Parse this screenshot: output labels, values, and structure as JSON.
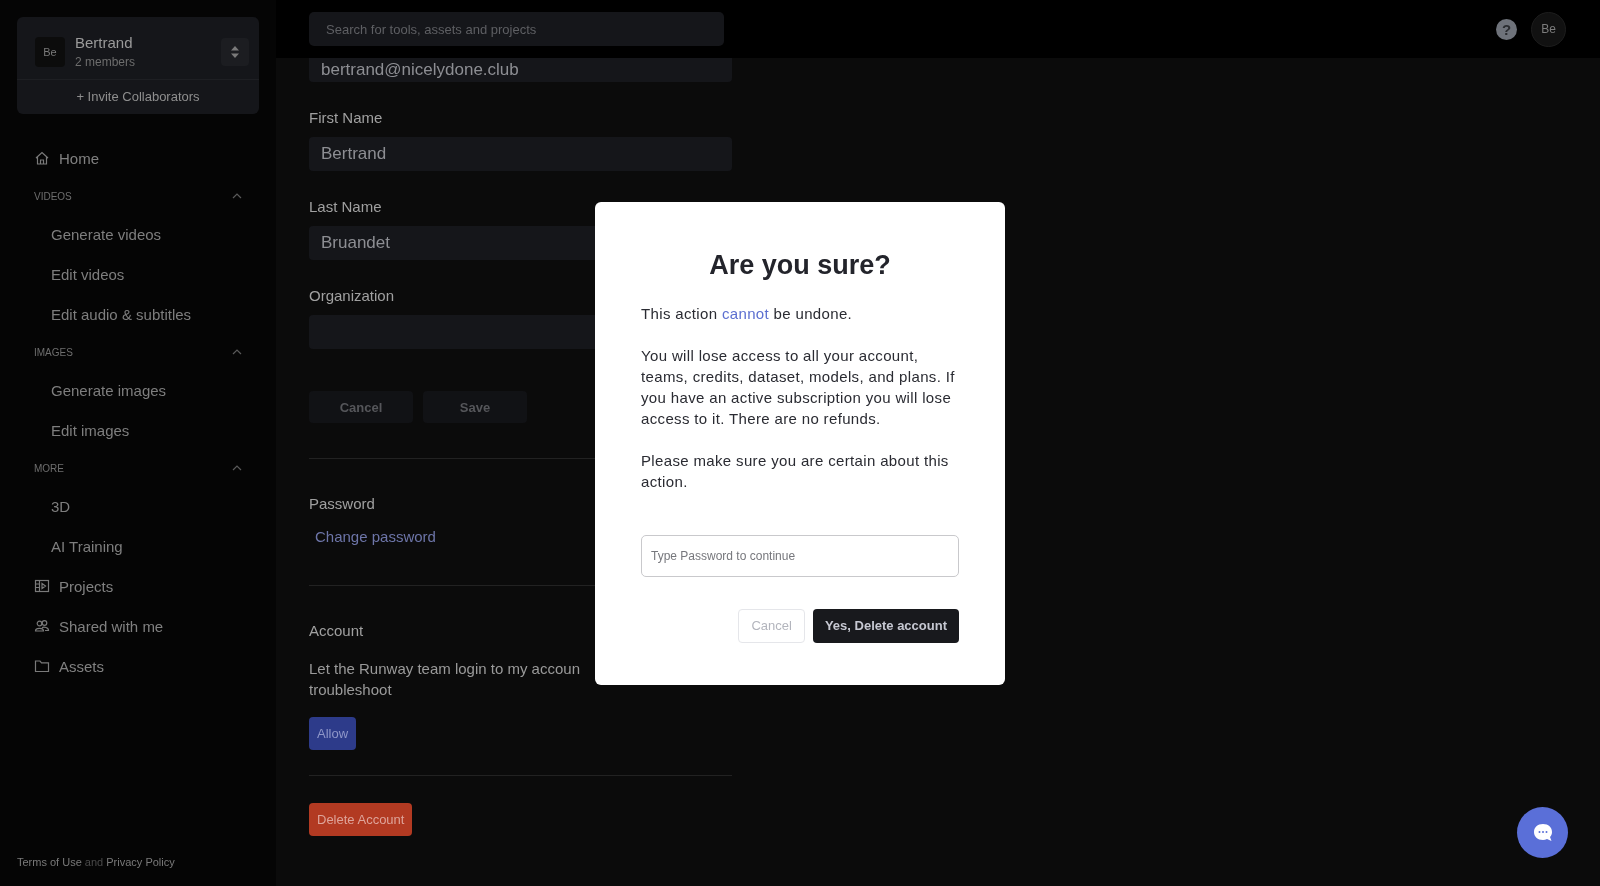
{
  "workspace": {
    "avatar": "Be",
    "name": "Bertrand",
    "members": "2 members",
    "invite": "+ Invite Collaborators"
  },
  "sidebar": {
    "items": [
      {
        "kind": "link",
        "label": "Home"
      },
      {
        "kind": "section",
        "label": "VIDEOS",
        "expanded": true,
        "children": [
          {
            "label": "Generate videos"
          },
          {
            "label": "Edit videos"
          },
          {
            "label": "Edit audio & subtitles"
          }
        ]
      },
      {
        "kind": "section",
        "label": "IMAGES",
        "expanded": true,
        "children": [
          {
            "label": "Generate images"
          },
          {
            "label": "Edit images"
          }
        ]
      },
      {
        "kind": "section",
        "label": "MORE",
        "expanded": true,
        "children": [
          {
            "label": "3D"
          },
          {
            "label": "AI Training"
          }
        ]
      },
      {
        "kind": "link",
        "label": "Projects"
      },
      {
        "kind": "link",
        "label": "Shared with me"
      },
      {
        "kind": "link",
        "label": "Assets"
      }
    ],
    "footer": {
      "terms": "Terms of Use",
      "and": "and",
      "privacy": "Privacy Policy"
    }
  },
  "header": {
    "search": {
      "placeholder": "Search for tools, assets and projects"
    },
    "help": "?",
    "avatar": "Be"
  },
  "profile": {
    "email": "bertrand@nicelydone.club",
    "fields": [
      {
        "label": "First Name",
        "value": "Bertrand"
      },
      {
        "label": "Last Name",
        "value": "Bruandet"
      },
      {
        "label": "Organization"
      }
    ],
    "buttons": [
      {
        "label": "Cancel",
        "disabled": true
      },
      {
        "label": "Save",
        "disabled": true
      }
    ],
    "password": {
      "label": "Password",
      "link": "Change password"
    },
    "account": {
      "label": "Account",
      "text_lines": [
        "Let the Runway team login to my accoun",
        "troubleshoot"
      ],
      "allow": "Allow"
    },
    "delete": "Delete Account"
  },
  "modal": {
    "title": "Are you sure?",
    "intro": {
      "before": "This action ",
      "emphasis": "cannot",
      "after": " be undone."
    },
    "paragraphs": [
      "You will lose access to all your account, teams, credits, dataset, models, and plans. If you have an active subscription you will lose access to it. There are no refunds.",
      "Please make sure you are certain about this action."
    ],
    "password": {
      "placeholder": "Type Password to continue"
    },
    "buttons": [
      {
        "kind": "secondary",
        "label": "Cancel",
        "disabled": true
      },
      {
        "kind": "danger",
        "label": "Yes, Delete account",
        "disabled": false
      }
    ]
  }
}
